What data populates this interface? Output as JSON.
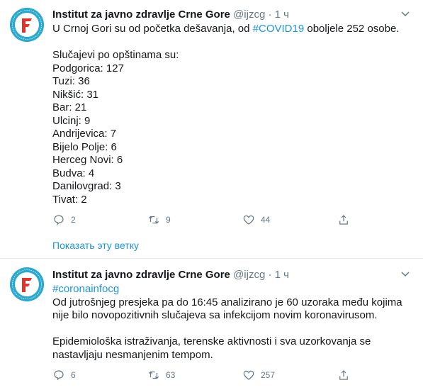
{
  "tweets": [
    {
      "author_name": "Institut za javno zdravlje Crne Gore",
      "handle": "@ijzcg",
      "dot": "·",
      "time": "1 ч",
      "text_before": "U Crnoj Gori su od početka dešavanja, od ",
      "hashtag": "#COVID19",
      "text_after": " oboljele 252 osobe.\n\nSlučajevi po opštinama su:\nPodgorica: 127\nTuzi: 36\nNikšić: 31\nBar: 21\nUlcinj: 9\nAndrijevica: 7\nBijelo Polje: 6\nHerceg Novi: 6\nBudva: 4\nDanilovgrad: 3\nTivat: 2",
      "replies": "2",
      "retweets": "9",
      "likes": "44",
      "show_thread": "Показать эту ветку"
    },
    {
      "author_name": "Institut za javno zdravlje Crne Gore",
      "handle": "@ijzcg",
      "dot": "·",
      "time": "1 ч",
      "hashtag": "#coronainfocg",
      "text_after": "\nOd jutrošnjeg presjeka pa do 16:45 analizirano je 60 uzoraka među kojima nije bilo novopozitivnih slučajeva sa infekcijom novim koronavirusom.\n\nEpidemiološka istraživanja, terenske aktivnosti i sva uzorkovanja se nastavljaju nesmanjenim tempom.",
      "replies": "6",
      "retweets": "63",
      "likes": "257"
    }
  ],
  "colors": {
    "link": "#1b95e0",
    "muted": "#657786",
    "avatar": "#29a9cf",
    "logo_red": "#e2332a"
  },
  "icons": [
    "logo-avatar",
    "chevron-down-icon",
    "reply-icon",
    "retweet-icon",
    "like-icon",
    "share-icon"
  ]
}
